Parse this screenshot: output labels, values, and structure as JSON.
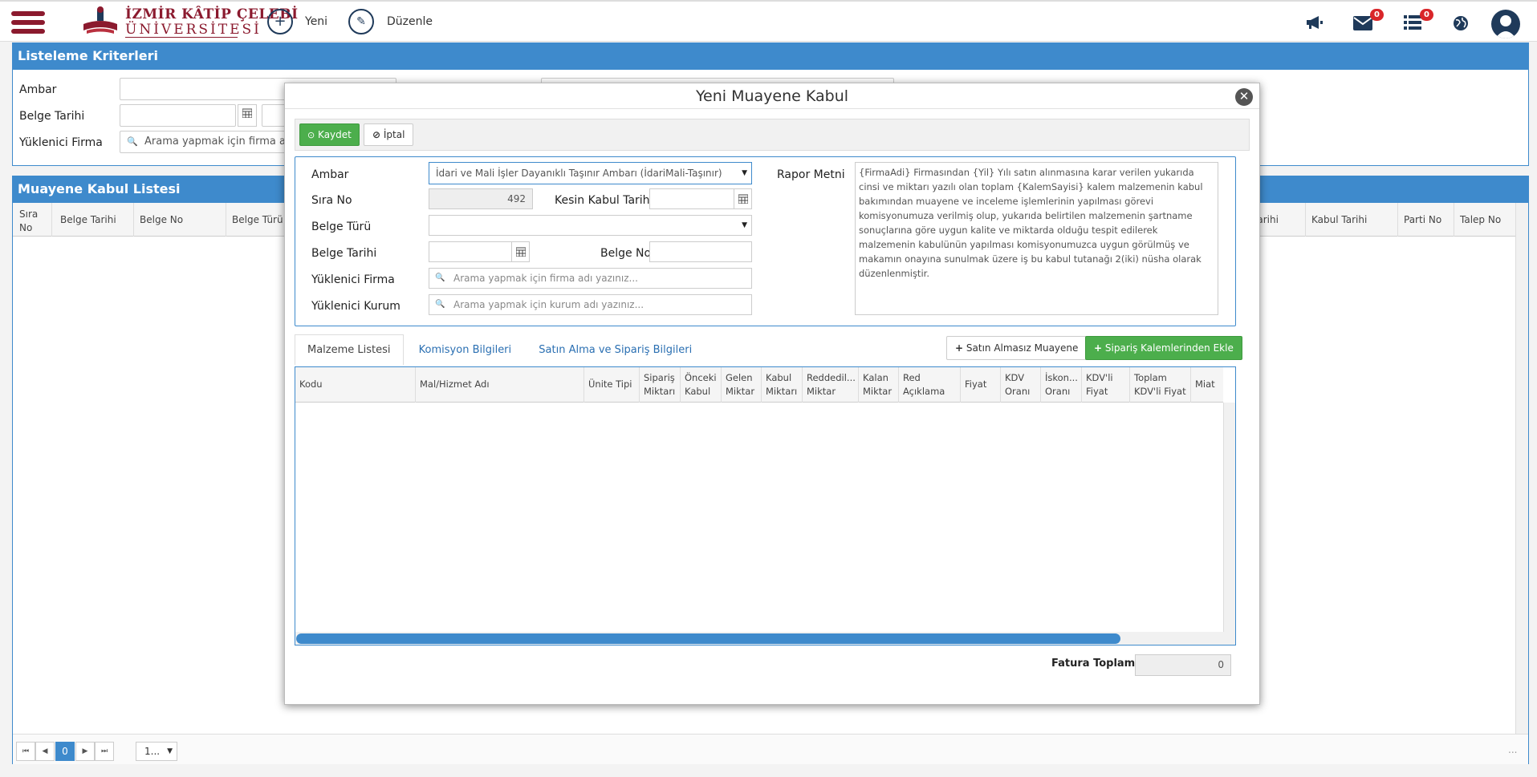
{
  "header": {
    "logo_line1": "İZMİR KÂTİP ÇELEBİ",
    "logo_line2": "ÜNİVERSİTESİ",
    "new_label": "Yeni",
    "edit_label": "Düzenle",
    "mail_badge": "0",
    "list_badge": "0"
  },
  "criteria": {
    "title": "Listeleme Kriterleri",
    "ambar_label": "Ambar",
    "belge_tarihi_label": "Belge Tarihi",
    "firma_label": "Yüklenici Firma",
    "firma_placeholder": "Arama yapmak için firma adı"
  },
  "list": {
    "title": "Muayene Kabul Listesi",
    "columns_left": [
      "Sıra No",
      "Belge Tarihi",
      "Belge No",
      "Belge Türü"
    ],
    "columns_right": [
      "Tarihi",
      "Kabul Tarihi",
      "Parti No",
      "Talep No"
    ],
    "pager": {
      "current": "0",
      "page_size": "1..."
    },
    "footer_dots": "..."
  },
  "modal": {
    "title": "Yeni Muayene Kabul",
    "save_label": "Kaydet",
    "cancel_label": "İptal",
    "form": {
      "ambar_label": "Ambar",
      "ambar_value": "İdari ve Mali İşler Dayanıklı Taşınır Ambarı (İdariMali-Taşınır)",
      "sira_no_label": "Sıra No",
      "sira_no_value": "492",
      "kesin_kabul_label": "Kesin Kabul Tarihi",
      "belge_turu_label": "Belge Türü",
      "belge_tarihi_label": "Belge Tarihi",
      "belge_no_label": "Belge No",
      "firma_label": "Yüklenici Firma",
      "firma_placeholder": "Arama yapmak için firma adı yazınız...",
      "kurum_label": "Yüklenici Kurum",
      "kurum_placeholder": "Arama yapmak için kurum adı yazınız...",
      "rapor_label": "Rapor Metni",
      "rapor_text": "{FirmaAdi} Firmasından {Yil} Yılı satın alınmasına karar verilen yukarıda cinsi ve miktarı yazılı olan toplam {KalemSayisi} kalem malzemenin kabul bakımından muayene ve inceleme işlemlerinin yapılması görevi komisyonumuza verilmiş olup, yukarıda belirtilen malzemenin şartname sonuçlarına göre uygun kalite ve miktarda olduğu tespit edilerek malzemenin kabulünün yapılması komisyonumuzca uygun görülmüş ve makamın onayına sunulmak üzere iş bu kabul tutanağı 2(iki) nüsha olarak düzenlenmiştir."
    },
    "tabs": [
      "Malzeme Listesi",
      "Komisyon Bilgileri",
      "Satın Alma ve Sipariş Bilgileri"
    ],
    "btn_satin_almasiz": "Satın Almasız Muayene",
    "btn_siparis_ekle": "Sipariş Kalemlerinden Ekle",
    "grid_columns": [
      {
        "l1": "Kodu",
        "l2": ""
      },
      {
        "l1": "Mal/Hizmet Adı",
        "l2": ""
      },
      {
        "l1": "Ünite Tipi",
        "l2": ""
      },
      {
        "l1": "Sipariş",
        "l2": "Miktarı"
      },
      {
        "l1": "Önceki",
        "l2": "Kabul"
      },
      {
        "l1": "Gelen",
        "l2": "Miktar"
      },
      {
        "l1": "Kabul",
        "l2": "Miktarı"
      },
      {
        "l1": "Reddedil...",
        "l2": "Miktar"
      },
      {
        "l1": "Kalan",
        "l2": "Miktar"
      },
      {
        "l1": "Red",
        "l2": "Açıklama"
      },
      {
        "l1": "Fiyat",
        "l2": ""
      },
      {
        "l1": "KDV",
        "l2": "Oranı"
      },
      {
        "l1": "İskon...",
        "l2": "Oranı"
      },
      {
        "l1": "KDV'li",
        "l2": "Fiyat"
      },
      {
        "l1": "Toplam",
        "l2": "KDV'li Fiyat"
      },
      {
        "l1": "Miat",
        "l2": ""
      }
    ],
    "fatura_label": "Fatura Toplamı",
    "fatura_value": "0"
  }
}
